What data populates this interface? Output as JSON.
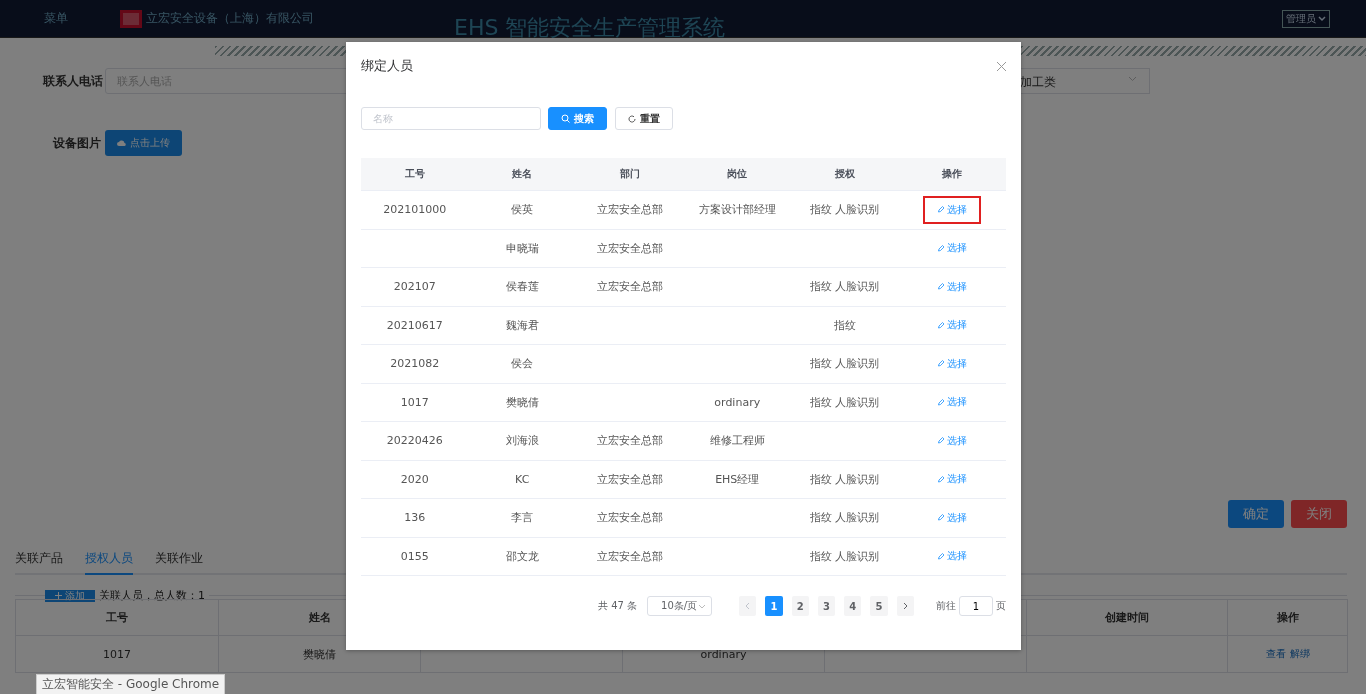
{
  "header": {
    "menu": "菜单",
    "company": "立宏安全设备（上海）有限公司",
    "title": "EHS 智能安全生产管理系统",
    "user": "管理员"
  },
  "form": {
    "phone_label": "联系人电话",
    "phone_placeholder": "联系人电话",
    "select_value": "加工类",
    "image_label": "设备图片",
    "upload_button": "点击上传"
  },
  "actions": [
    "确定",
    "关闭"
  ],
  "tabs": [
    {
      "label": "关联产品",
      "selected": false
    },
    {
      "label": "授权人员",
      "selected": true
    },
    {
      "label": "关联作业",
      "selected": false
    }
  ],
  "people_panel": {
    "add_button": "添加",
    "summary": "关联人员，总人数：1"
  },
  "bound_table": {
    "columns": [
      {
        "label": "工号"
      },
      {
        "label": "姓名"
      },
      {},
      {},
      {},
      {
        "label": "创建时间"
      },
      {
        "label": "操作"
      }
    ],
    "rows": [
      {
        "cells": [
          "1017",
          "樊晓倩",
          null,
          "ordinary",
          null,
          null
        ],
        "links": [
          "查看",
          "解绑"
        ]
      }
    ]
  },
  "dialog": {
    "title": "绑定人员",
    "search_placeholder": "名称",
    "search_button": "搜索",
    "reset_button": "重置",
    "columns": [
      "工号",
      "姓名",
      "部门",
      "岗位",
      "授权",
      "操作"
    ],
    "rows": [
      {
        "cells": [
          "202101000",
          "侯英",
          "立宏安全总部",
          "方案设计部经理",
          "指纹 人脸识别"
        ],
        "action": "选择",
        "highlighted": true
      },
      {
        "cells": [
          null,
          "申晓瑞",
          "立宏安全总部",
          null,
          null
        ],
        "action": "选择",
        "highlighted": false
      },
      {
        "cells": [
          "202107",
          "侯春莲",
          "立宏安全总部",
          null,
          "指纹 人脸识别"
        ],
        "action": "选择",
        "highlighted": false
      },
      {
        "cells": [
          "20210617",
          "魏海君",
          null,
          null,
          "指纹"
        ],
        "action": "选择",
        "highlighted": false
      },
      {
        "cells": [
          "2021082",
          "侯会",
          null,
          null,
          "指纹 人脸识别"
        ],
        "action": "选择",
        "highlighted": false
      },
      {
        "cells": [
          "1017",
          "樊晓倩",
          null,
          "ordinary",
          "指纹 人脸识别"
        ],
        "action": "选择",
        "highlighted": false
      },
      {
        "cells": [
          "20220426",
          "刘海浪",
          "立宏安全总部",
          "维修工程师",
          null
        ],
        "action": "选择",
        "highlighted": false
      },
      {
        "cells": [
          "2020",
          "KC",
          "立宏安全总部",
          "EHS经理",
          "指纹 人脸识别"
        ],
        "action": "选择",
        "highlighted": false
      },
      {
        "cells": [
          "136",
          "李言",
          "立宏安全总部",
          null,
          "指纹 人脸识别"
        ],
        "action": "选择",
        "highlighted": false
      },
      {
        "cells": [
          "0155",
          "邵文龙",
          "立宏安全总部",
          null,
          "指纹 人脸识别"
        ],
        "action": "选择",
        "highlighted": false
      }
    ],
    "pagination": {
      "total": "共 47 条",
      "page_size": "10条/页",
      "pages": [
        {
          "label": "1",
          "selected": true
        },
        {
          "label": "2",
          "selected": false
        },
        {
          "label": "3",
          "selected": false
        },
        {
          "label": "4",
          "selected": false
        },
        {
          "label": "5",
          "selected": false
        }
      ],
      "goto_label": "前往",
      "goto_value": "1",
      "page_suffix": "页"
    }
  },
  "tooltip": "立宏智能安全 - Google Chrome"
}
